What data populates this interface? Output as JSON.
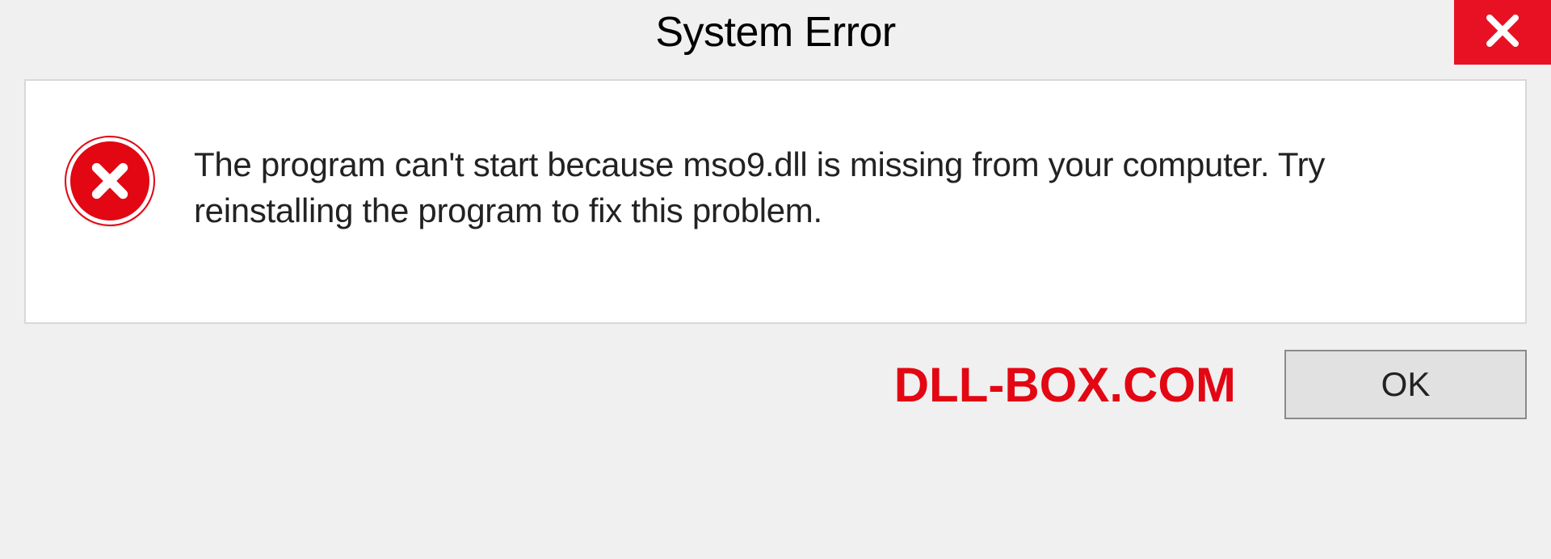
{
  "titlebar": {
    "title": "System Error"
  },
  "dialog": {
    "message": "The program can't start because mso9.dll is missing from your computer. Try reinstalling the program to fix this problem."
  },
  "footer": {
    "watermark": "DLL-BOX.COM",
    "ok_label": "OK"
  },
  "colors": {
    "accent_red": "#e30613",
    "close_red": "#e81123"
  }
}
